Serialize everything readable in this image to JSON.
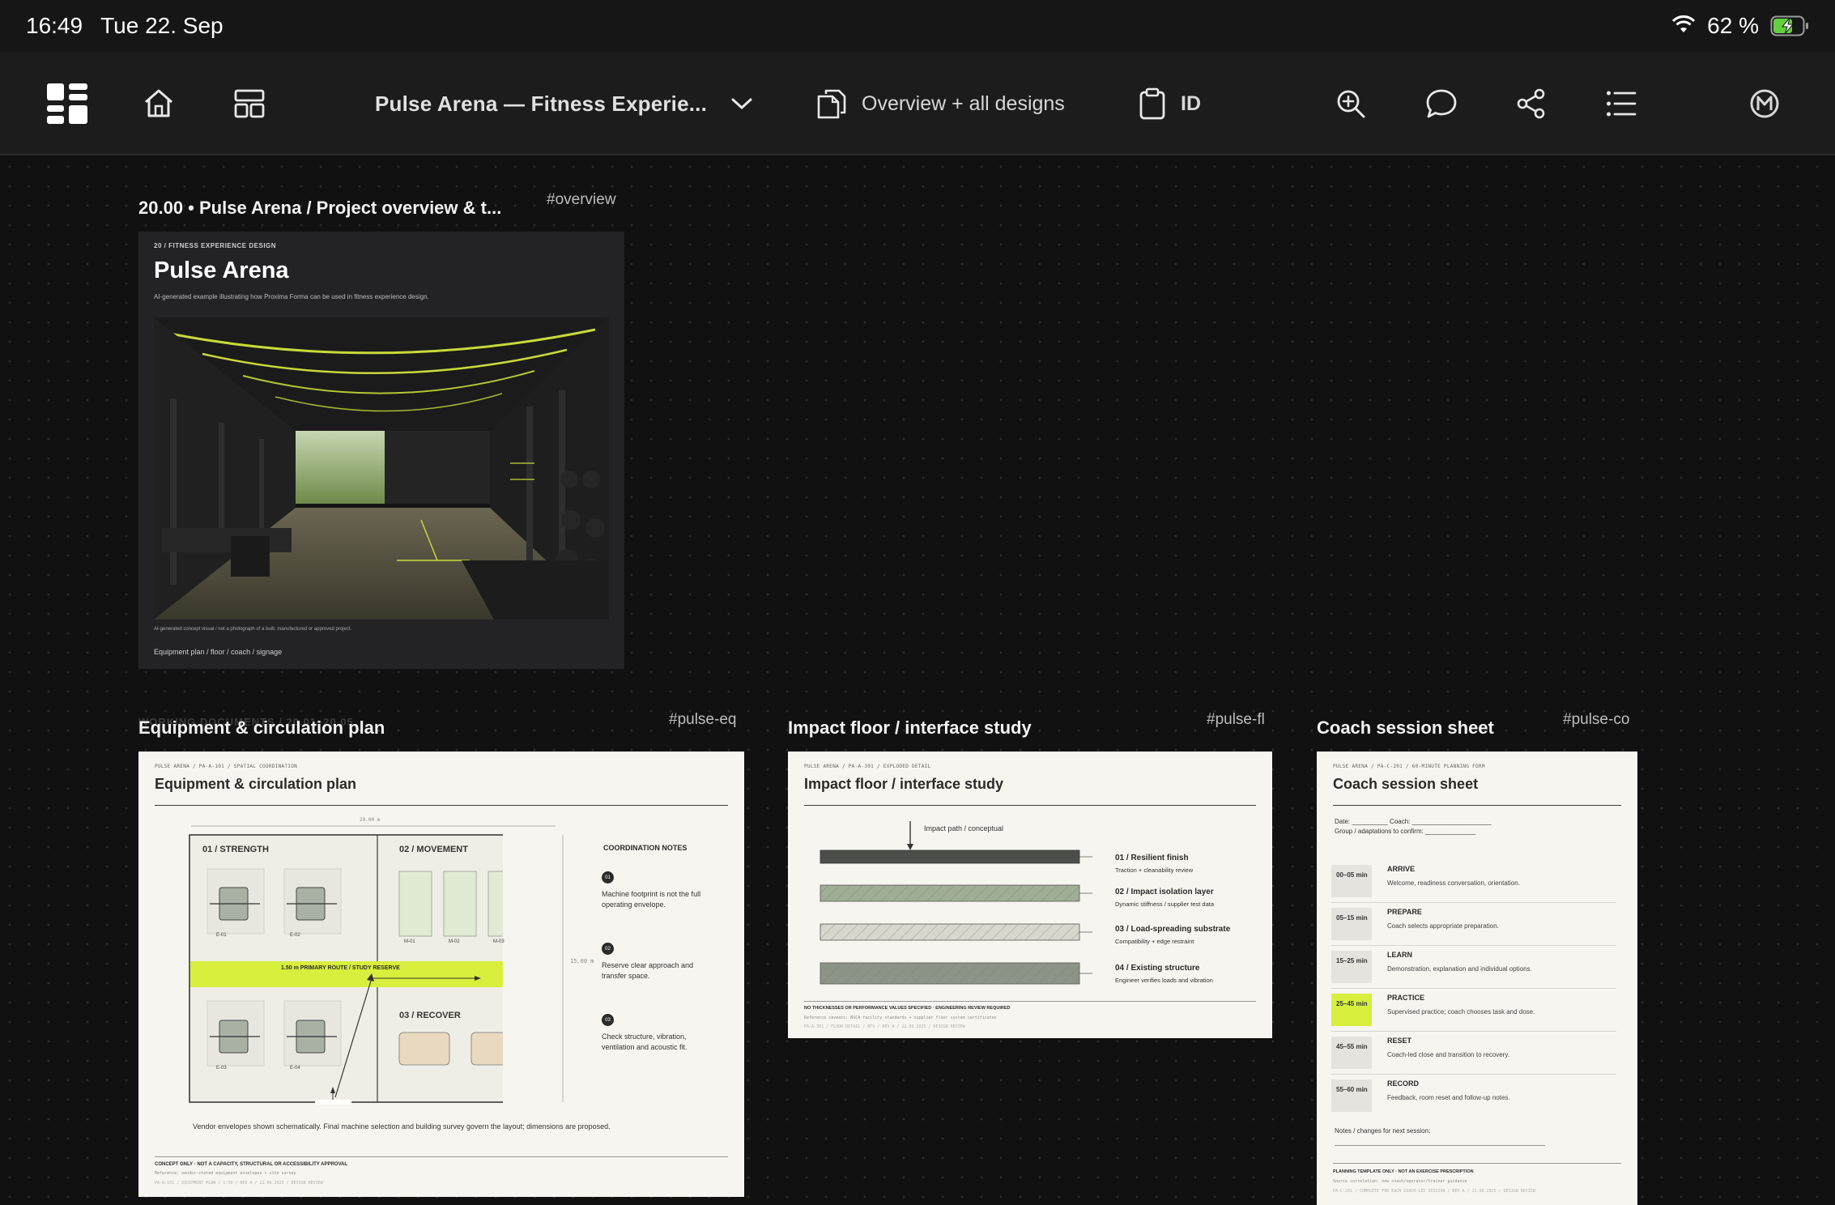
{
  "status_bar": {
    "time": "16:49",
    "date": "Tue 22. Sep",
    "battery_percent": "62 %",
    "battery_level": 0.62
  },
  "toolbar": {
    "document_title": "Pulse Arena — Fitness Experie...",
    "view_mode_label": "Overview + all designs",
    "id_label": "ID",
    "icons": [
      "grid-view-icon",
      "home-icon",
      "layout-icon",
      "chevron-down-icon",
      "pages-icon",
      "clipboard-icon",
      "zoom-in-icon",
      "comment-icon",
      "share-icon",
      "list-icon",
      "avatar-badge"
    ]
  },
  "boards": {
    "overview": {
      "title": "20.00 • Pulse Arena / Project overview & t...",
      "tag": "#overview",
      "kicker": "20 / FITNESS EXPERIENCE DESIGN",
      "heading": "Pulse Arena",
      "subtitle": "AI-generated example illustrating how Proxima Forma can be used in fitness experience design.",
      "caption": "AI-generated concept visual / not a photograph of a built, manufactured or approved project.",
      "footer": "Equipment plan / floor / coach / signage",
      "ghost_label": "WORKING DOCUMENTS / 20.01–20.05"
    },
    "equipment": {
      "title": "Equipment & circulation plan",
      "tag": "#pulse-eq",
      "kicker": "PULSE ARENA / PA-A-101 / SPATIAL COORDINATION",
      "heading": "Equipment & circulation plan",
      "dimension_top": "20.00 m",
      "dimension_side": "15.00 m",
      "zones": {
        "strength": "01 / STRENGTH",
        "movement": "02 / MOVEMENT",
        "recover": "03 / RECOVER"
      },
      "machines_top": [
        "E-01",
        "E-02"
      ],
      "machines_bottom": [
        "E-03",
        "E-04"
      ],
      "mats": [
        "M-01",
        "M-02",
        "M-03"
      ],
      "route_label": "1.50 m PRIMARY ROUTE / STUDY RESERVE",
      "notes_title": "COORDINATION NOTES",
      "notes": [
        {
          "num": "01",
          "text": "Machine footprint is not the full operating envelope."
        },
        {
          "num": "02",
          "text": "Reserve clear approach and transfer space."
        },
        {
          "num": "03",
          "text": "Check structure, vibration, ventilation and acoustic fit."
        }
      ],
      "vendor_note": "Vendor envelopes shown schematically. Final machine selection and building survey govern the layout; dimensions are proposed.",
      "disclaimer": "CONCEPT ONLY · NOT A CAPACITY, STRUCTURAL OR ACCESSIBILITY APPROVAL",
      "reference": "Reference: vendor-stated equipment envelopes + site survey",
      "meta": "PA-A-101 / EQUIPMENT PLAN / 1:50 / REV A / 22.09.2025 / DESIGN REVIEW"
    },
    "floor": {
      "title": "Impact floor / interface study",
      "tag": "#pulse-fl",
      "kicker": "PULSE ARENA / PA-A-301 / EXPLODED DETAIL",
      "heading": "Impact floor / interface study",
      "impact_label": "Impact path / conceptual",
      "layers": [
        {
          "name": "01 / Resilient finish",
          "desc": "Traction + cleanability review"
        },
        {
          "name": "02 / Impact isolation layer",
          "desc": "Dynamic stiffness / supplier test data"
        },
        {
          "name": "03 / Load-spreading substrate",
          "desc": "Compatibility + edge restraint"
        },
        {
          "name": "04 / Existing structure",
          "desc": "Engineer verifies loads and vibration"
        }
      ],
      "disclaimer": "NO THICKNESSES OR PERFORMANCE VALUES SPECIFIED · ENGINEERING REVIEW REQUIRED",
      "reference": "Reference caveats: NSCA facility standards + supplier floor system certificates",
      "meta": "PA-A-301 / FLOOR DETAIL / NTS / REV A / 22.09.2025 / DESIGN REVIEW"
    },
    "coach": {
      "title": "Coach session sheet",
      "tag": "#pulse-co",
      "kicker": "PULSE ARENA / PA-C-201 / 60-MINUTE PLANNING FORM",
      "heading": "Coach session sheet",
      "date_line": "Date: __________  Coach: ______________________",
      "group_line": "Group / adaptations to confirm: ______________",
      "rows": [
        {
          "time": "00–05 min",
          "name": "ARRIVE",
          "desc": "Welcome, readiness conversation, orientation.",
          "highlight": false
        },
        {
          "time": "05–15 min",
          "name": "PREPARE",
          "desc": "Coach selects appropriate preparation.",
          "highlight": false
        },
        {
          "time": "15–25 min",
          "name": "LEARN",
          "desc": "Demonstration, explanation and individual options.",
          "highlight": false
        },
        {
          "time": "25–45 min",
          "name": "PRACTICE",
          "desc": "Supervised practice; coach chooses task and dose.",
          "highlight": true
        },
        {
          "time": "45–55 min",
          "name": "RESET",
          "desc": "Coach-led close and transition to recovery.",
          "highlight": false
        },
        {
          "time": "55–60 min",
          "name": "RECORD",
          "desc": "Feedback, room reset and follow-up notes.",
          "highlight": false
        }
      ],
      "notes_label": "Notes / changes for next session:",
      "disclaimer": "PLANNING TEMPLATE ONLY · NOT AN EXERCISE PRESCRIPTION",
      "reference": "Source correlation: new coach/operator/trainer guidance",
      "meta": "PA-C-201 / COMPLETE FOR EACH COACH-LED SESSION / REV A / 22.09.2025 / DESIGN REVIEW"
    }
  },
  "colors": {
    "accent_lime": "#d8ef3d",
    "toolbar_bg": "#1c1c1d",
    "canvas_bg": "#111112",
    "sheet_light": "#f6f5ef",
    "sheet_dark": "#232325"
  }
}
